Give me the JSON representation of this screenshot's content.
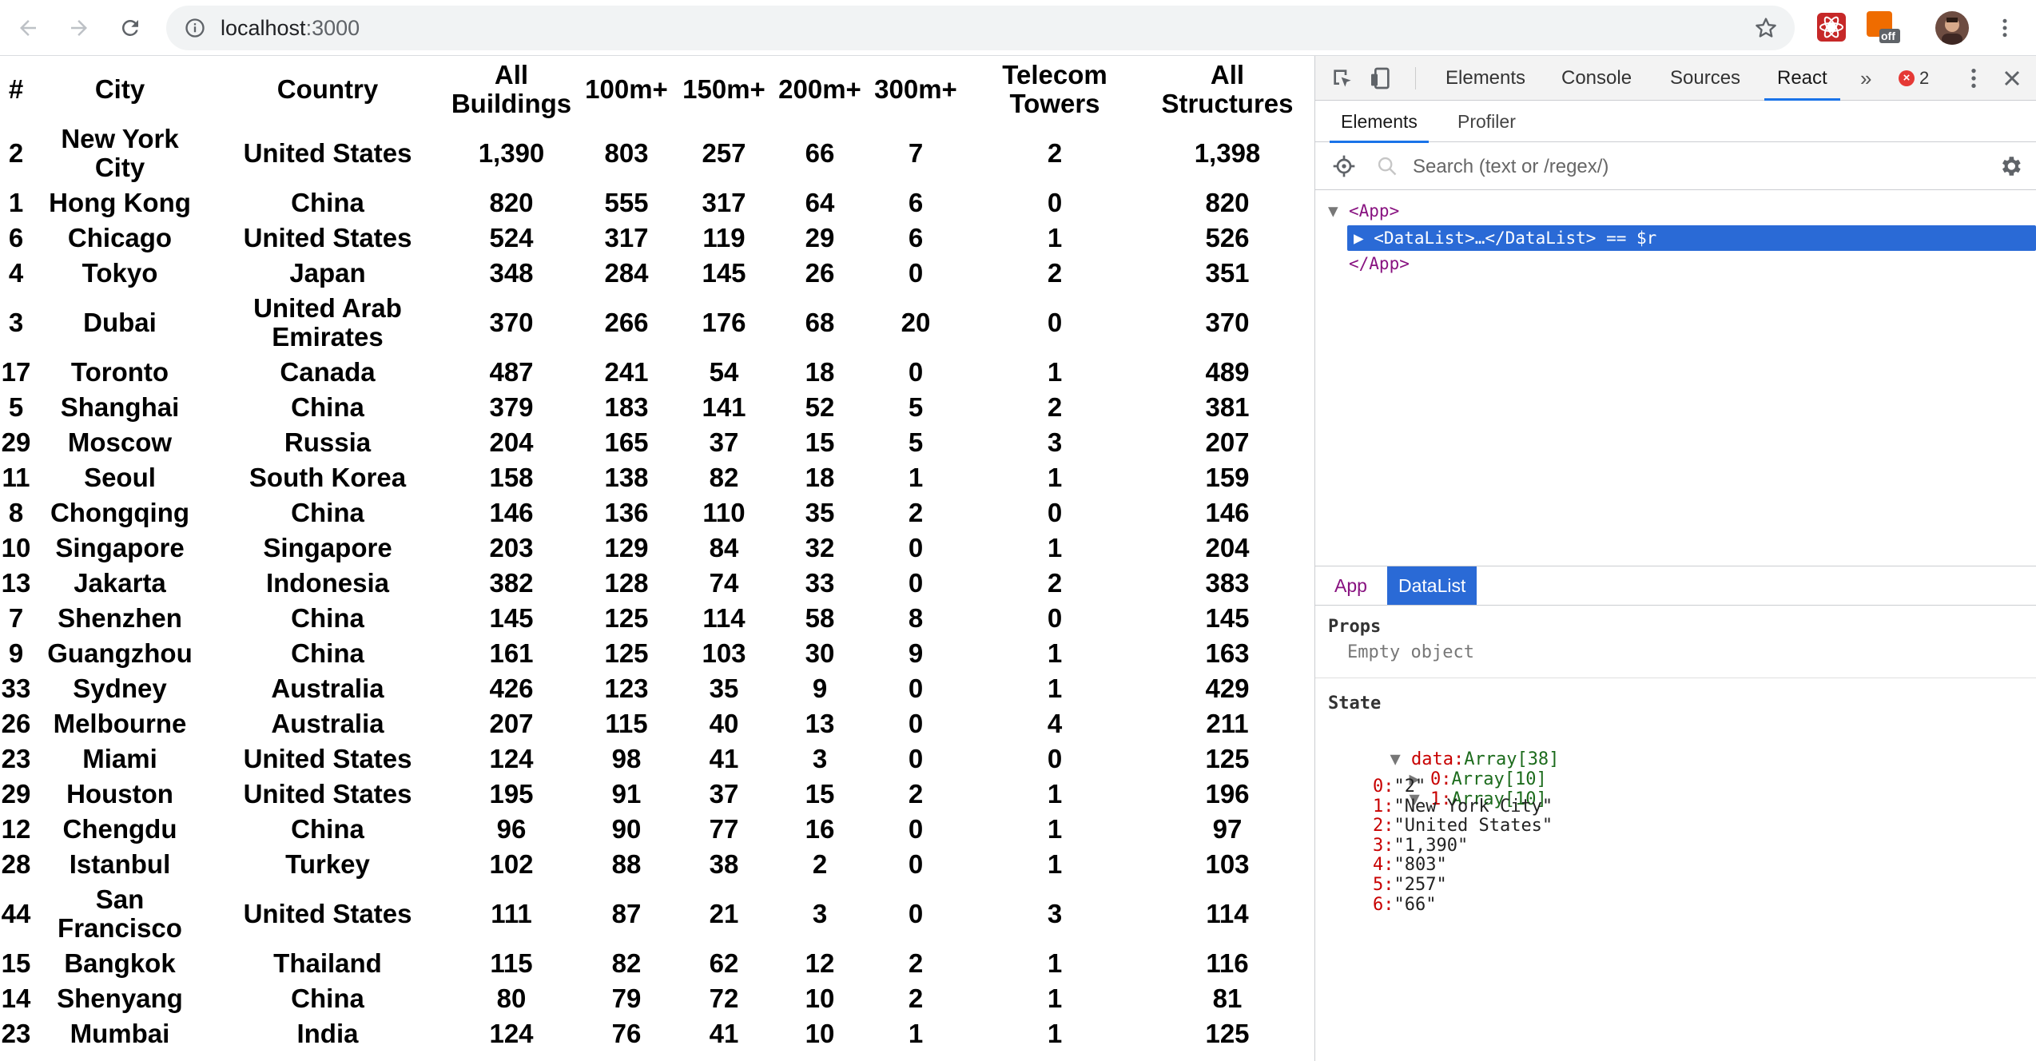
{
  "browser": {
    "url_host": "localhost",
    "url_port": ":3000",
    "extension_badge": "off"
  },
  "table": {
    "headers": [
      "#",
      "City",
      "Country",
      "All Buildings",
      "100m+",
      "150m+",
      "200m+",
      "300m+",
      "Telecom Towers",
      "All Structures"
    ],
    "rows": [
      [
        "2",
        "New York City",
        "United States",
        "1,390",
        "803",
        "257",
        "66",
        "7",
        "2",
        "1,398"
      ],
      [
        "1",
        "Hong Kong",
        "China",
        "820",
        "555",
        "317",
        "64",
        "6",
        "0",
        "820"
      ],
      [
        "6",
        "Chicago",
        "United States",
        "524",
        "317",
        "119",
        "29",
        "6",
        "1",
        "526"
      ],
      [
        "4",
        "Tokyo",
        "Japan",
        "348",
        "284",
        "145",
        "26",
        "0",
        "2",
        "351"
      ],
      [
        "3",
        "Dubai",
        "United Arab Emirates",
        "370",
        "266",
        "176",
        "68",
        "20",
        "0",
        "370"
      ],
      [
        "17",
        "Toronto",
        "Canada",
        "487",
        "241",
        "54",
        "18",
        "0",
        "1",
        "489"
      ],
      [
        "5",
        "Shanghai",
        "China",
        "379",
        "183",
        "141",
        "52",
        "5",
        "2",
        "381"
      ],
      [
        "29",
        "Moscow",
        "Russia",
        "204",
        "165",
        "37",
        "15",
        "5",
        "3",
        "207"
      ],
      [
        "11",
        "Seoul",
        "South Korea",
        "158",
        "138",
        "82",
        "18",
        "1",
        "1",
        "159"
      ],
      [
        "8",
        "Chongqing",
        "China",
        "146",
        "136",
        "110",
        "35",
        "2",
        "0",
        "146"
      ],
      [
        "10",
        "Singapore",
        "Singapore",
        "203",
        "129",
        "84",
        "32",
        "0",
        "1",
        "204"
      ],
      [
        "13",
        "Jakarta",
        "Indonesia",
        "382",
        "128",
        "74",
        "33",
        "0",
        "2",
        "383"
      ],
      [
        "7",
        "Shenzhen",
        "China",
        "145",
        "125",
        "114",
        "58",
        "8",
        "0",
        "145"
      ],
      [
        "9",
        "Guangzhou",
        "China",
        "161",
        "125",
        "103",
        "30",
        "9",
        "1",
        "163"
      ],
      [
        "33",
        "Sydney",
        "Australia",
        "426",
        "123",
        "35",
        "9",
        "0",
        "1",
        "429"
      ],
      [
        "26",
        "Melbourne",
        "Australia",
        "207",
        "115",
        "40",
        "13",
        "0",
        "4",
        "211"
      ],
      [
        "23",
        "Miami",
        "United States",
        "124",
        "98",
        "41",
        "3",
        "0",
        "0",
        "125"
      ],
      [
        "29",
        "Houston",
        "United States",
        "195",
        "91",
        "37",
        "15",
        "2",
        "1",
        "196"
      ],
      [
        "12",
        "Chengdu",
        "China",
        "96",
        "90",
        "77",
        "16",
        "0",
        "1",
        "97"
      ],
      [
        "28",
        "Istanbul",
        "Turkey",
        "102",
        "88",
        "38",
        "2",
        "0",
        "1",
        "103"
      ],
      [
        "44",
        "San Francisco",
        "United States",
        "111",
        "87",
        "21",
        "3",
        "0",
        "3",
        "114"
      ],
      [
        "15",
        "Bangkok",
        "Thailand",
        "115",
        "82",
        "62",
        "12",
        "2",
        "1",
        "116"
      ],
      [
        "14",
        "Shenyang",
        "China",
        "80",
        "79",
        "72",
        "10",
        "2",
        "1",
        "81"
      ],
      [
        "23",
        "Mumbai",
        "India",
        "124",
        "76",
        "41",
        "10",
        "1",
        "1",
        "125"
      ]
    ]
  },
  "devtools": {
    "tabs": [
      "Elements",
      "Console",
      "Sources",
      "React"
    ],
    "active_tab": "React",
    "more": "»",
    "error_count": "2",
    "react_tabs": [
      "Elements",
      "Profiler"
    ],
    "search_placeholder": "Search (text or /regex/)",
    "tree": {
      "app_open": "<App>",
      "datalist": "▶ <DataList>…</DataList> == $r",
      "app_close": "</App>"
    },
    "breadcrumbs": [
      "App",
      "DataList"
    ],
    "props_title": "Props",
    "props_empty": "Empty object",
    "state_title": "State",
    "state": {
      "data_key": "data:",
      "data_type": "Array[38]",
      "item0_key": "0:",
      "item0_type": "Array[10]",
      "item1_key": "1:",
      "item1_type": "Array[10]",
      "entries": [
        {
          "k": "0:",
          "v": "\"2\""
        },
        {
          "k": "1:",
          "v": "\"New York City\""
        },
        {
          "k": "2:",
          "v": "\"United States\""
        },
        {
          "k": "3:",
          "v": "\"1,390\""
        },
        {
          "k": "4:",
          "v": "\"803\""
        },
        {
          "k": "5:",
          "v": "\"257\""
        },
        {
          "k": "6:",
          "v": "\"66\""
        }
      ]
    }
  },
  "colors": {
    "accent": "#1a73e8",
    "selection": "#2a6ad6",
    "error": "#e53935",
    "tag": "#881280"
  }
}
